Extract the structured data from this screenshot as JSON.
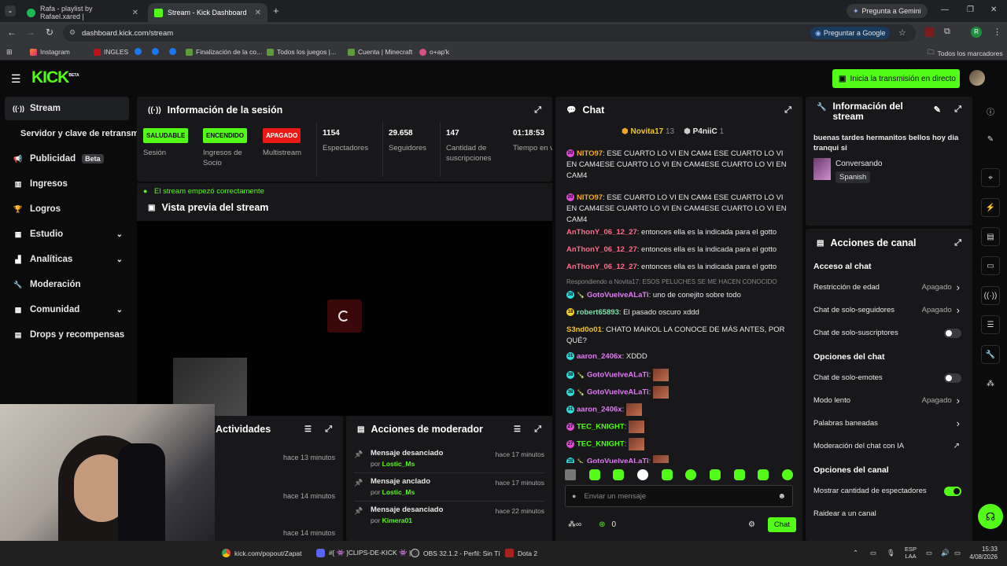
{
  "browser": {
    "tabs": [
      {
        "title": "Rafa - playlist by Rafael.xared |",
        "active": false
      },
      {
        "title": "Stream - Kick Dashboard",
        "active": true
      }
    ],
    "gemini": "Pregunta a Gemini",
    "url": "dashboard.kick.com/stream",
    "google_btn": "Preguntar a Google",
    "profile_initial": "R",
    "bookmarks": [
      "Instagram",
      "INGLES",
      "Finalización de la co...",
      "Todos los juegos |...",
      "Cuenta | Minecraft",
      "o+ap'k"
    ],
    "all_bookmarks": "Todos los marcadores"
  },
  "app": {
    "logo": "KICK",
    "logo_beta": "BETA",
    "go_live": "Inicia la transmisión en directo",
    "accent": "#53fc18",
    "sidebar": [
      {
        "label": "Stream",
        "icon": "broadcast-icon",
        "active": true
      },
      {
        "label": "Servidor y clave de retransmisión",
        "icon": "",
        "active": false
      },
      {
        "label": "Publicidad",
        "icon": "megaphone-icon",
        "badge": "Beta"
      },
      {
        "label": "Ingresos",
        "icon": "chart-icon"
      },
      {
        "label": "Logros",
        "icon": "trophy-icon"
      },
      {
        "label": "Estudio",
        "icon": "studio-icon",
        "chevron": true
      },
      {
        "label": "Analíticas",
        "icon": "analytics-icon",
        "chevron": true
      },
      {
        "label": "Moderación",
        "icon": "wrench-icon"
      },
      {
        "label": "Comunidad",
        "icon": "community-icon",
        "chevron": true
      },
      {
        "label": "Drops y recompensas",
        "icon": "gift-icon"
      }
    ],
    "session": {
      "title": "Información de la sesión",
      "stats": [
        {
          "pill": "SALUDABLE",
          "label": "Sesión",
          "pill_color": "#53fc18"
        },
        {
          "pill": "ENCENDIDO",
          "label": "Ingresos de Socio",
          "pill_color": "#53fc18"
        },
        {
          "pill": "APAGADO",
          "label": "Multistream",
          "pill_color": "#e91916"
        },
        {
          "value": "1154",
          "label": "Espectadores"
        },
        {
          "value": "29.658",
          "label": "Seguidores"
        },
        {
          "value": "147",
          "label": "Cantidad de suscripciones"
        },
        {
          "value": "01:18:53",
          "label": "Tiempo en vivo"
        }
      ],
      "notice": "El stream empezó correctamente"
    },
    "preview": {
      "title": "Vista previa del stream"
    },
    "activity": {
      "title": "Actividades",
      "times": [
        "hace 13 minutos",
        "hace 14 minutos",
        "hace 14 minutos"
      ]
    },
    "modactions": {
      "title": "Acciones de moderador",
      "rows": [
        {
          "action": "Mensaje desanciado",
          "by": "por",
          "user": "Lostic_Ms",
          "time": "hace 17 minutos"
        },
        {
          "action": "Mensaje anclado",
          "by": "por",
          "user": "Lostic_Ms",
          "time": "hace 17 minutos"
        },
        {
          "action": "Mensaje desanciado",
          "by": "por",
          "user": "Kimera01",
          "time": "hace 22 minutos"
        }
      ]
    },
    "chat": {
      "title": "Chat",
      "top_gifters": [
        {
          "name": "Novita17",
          "count": "13"
        },
        {
          "name": "P4niiC",
          "count": "1"
        }
      ],
      "reply_ctx": "Respondiendo a Novita17: ESOS PELUCHES SE ME HACEN CONOCIDO",
      "input_placeholder": "Enviar un mensaje",
      "points": "0",
      "send": "Chat",
      "messages": [
        {
          "user": "NITO97",
          "color": "#f5a623",
          "badge": "20",
          "badge_color": "#e24bd8",
          "text": "ESE CUARTO LO VI EN CAM4 ESE CUARTO LO VI EN CAM4ESE CUARTO LO VI EN CAM4ESE CUARTO LO VI EN CAM4"
        },
        {
          "user": "NITO97",
          "color": "#f5a623",
          "badge": "20",
          "badge_color": "#e24bd8",
          "text": "ESE CUARTO LO VI EN CAM4 ESE CUARTO LO VI EN CAM4ESE CUARTO LO VI EN CAM4ESE CUARTO LO VI EN CAM4"
        },
        {
          "user": "AnThonY_06_12_27",
          "color": "#ff6b8a",
          "text": "entonces ella es la indicada para el gotto"
        },
        {
          "user": "AnThonY_06_12_27",
          "color": "#ff6b8a",
          "text": "entonces ella es la indicada para el gotto"
        },
        {
          "user": "AnThonY_06_12_27",
          "color": "#ff6b8a",
          "text": "entonces ella es la indicada para el gotto"
        },
        {
          "user": "GotoVuelveALaTi",
          "color": "#e27bf5",
          "badge": "38",
          "badge_color": "#2de1e1",
          "text": "uno de conejito sobre todo"
        },
        {
          "user": "robert65893",
          "color": "#7be3a8",
          "badge": "18",
          "badge_color": "#f5d423",
          "text": "El pasado oscuro xddd"
        },
        {
          "user": "S3nd0o01",
          "color": "#f5c623",
          "text": "CHATO MAIKOL LA CONOCE DE MÁS ANTES, POR QUÉ?"
        },
        {
          "user": "aaron_2406x",
          "color": "#e27bf5",
          "badge": "31",
          "badge_color": "#2de1e1",
          "text": "XDDD"
        },
        {
          "user": "GotoVuelveALaTi",
          "color": "#e27bf5",
          "badge": "38",
          "badge_color": "#2de1e1",
          "text": ""
        },
        {
          "user": "GotoVuelveALaTi",
          "color": "#e27bf5",
          "badge": "38",
          "badge_color": "#2de1e1",
          "text": ""
        },
        {
          "user": "aaron_2406x",
          "color": "#e27bf5",
          "badge": "31",
          "badge_color": "#2de1e1",
          "text": ""
        },
        {
          "user": "TEC_KNIGHT",
          "color": "#53fc18",
          "badge": "27",
          "badge_color": "#e24bd8",
          "text": ""
        },
        {
          "user": "TEC_KNIGHT",
          "color": "#53fc18",
          "badge": "27",
          "badge_color": "#e24bd8",
          "text": ""
        },
        {
          "user": "GotoVuelveALaTi",
          "color": "#e27bf5",
          "badge": "38",
          "badge_color": "#2de1e1",
          "text": ""
        }
      ]
    },
    "stream_info": {
      "title": "Información del stream",
      "stream_title": "buenas tardes hermanitos bellos hoy dia tranqui si",
      "category": "Conversando",
      "language": "Spanish"
    },
    "channel_actions": {
      "title": "Acciones de canal",
      "sections": [
        {
          "name": "Acceso al chat",
          "rows": [
            {
              "label": "Restricción de edad",
              "value": "Apagado",
              "kind": "link"
            },
            {
              "label": "Chat de solo-seguidores",
              "value": "Apagado",
              "kind": "link"
            },
            {
              "label": "Chat de solo-suscriptores",
              "kind": "toggle",
              "on": false
            }
          ]
        },
        {
          "name": "Opciones del chat",
          "rows": [
            {
              "label": "Chat de solo-emotes",
              "kind": "toggle",
              "on": false
            },
            {
              "label": "Modo lento",
              "value": "Apagado",
              "kind": "link"
            },
            {
              "label": "Palabras baneadas",
              "kind": "link"
            },
            {
              "label": "Moderación del chat con IA",
              "kind": "external"
            }
          ]
        },
        {
          "name": "Opciones del canal",
          "rows": [
            {
              "label": "Mostrar cantidad de espectadores",
              "kind": "toggle",
              "on": true
            },
            {
              "label": "Raidear a un canal",
              "kind": "none"
            }
          ]
        }
      ]
    }
  },
  "taskbar": {
    "items": [
      "kick.com/popout/Zapat",
      "#[ 👾 ]CLIPS-DE-KICK 👾 |",
      "OBS 32.1.2 - Perfil: Sin Tí",
      "Dota 2"
    ],
    "lang": "ESP",
    "lang2": "LAA",
    "time": "15:33",
    "date": "4/08/2026"
  }
}
